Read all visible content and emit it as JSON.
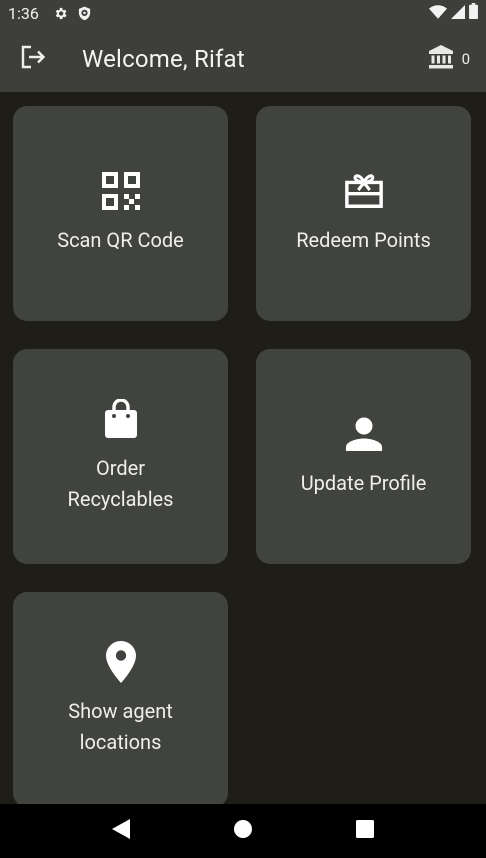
{
  "status_bar": {
    "time": "1:36",
    "icons": [
      "gear-icon",
      "shield-icon",
      "wifi-icon",
      "signal-icon",
      "battery-icon"
    ]
  },
  "app_bar": {
    "title": "Welcome, Rifat",
    "logout_icon": "logout-icon",
    "balance_icon": "bank-icon",
    "balance_value": "0"
  },
  "tiles": [
    {
      "label": "Scan QR Code",
      "icon": "qr-code-icon"
    },
    {
      "label": "Redeem Points",
      "icon": "gift-card-icon"
    },
    {
      "label": "Order Recyclables",
      "icon": "shopping-bag-icon"
    },
    {
      "label": "Update Profile",
      "icon": "person-icon"
    },
    {
      "label": "Show agent locations",
      "icon": "location-pin-icon"
    }
  ],
  "nav_bar": {
    "back_icon": "back-icon",
    "home_icon": "home-icon",
    "recents_icon": "recents-icon"
  },
  "colors": {
    "background": "#1e1e17",
    "bar": "#3e3f3b",
    "tile": "#41433e",
    "text": "#eeeeea"
  }
}
